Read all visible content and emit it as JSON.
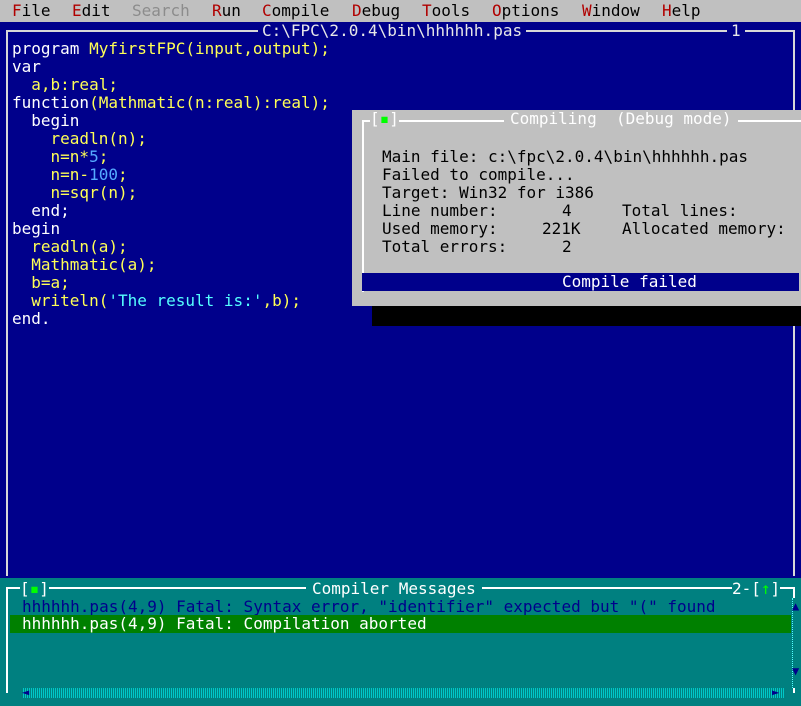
{
  "menu": [
    {
      "hotkey": "F",
      "rest": "ile",
      "enabled": true
    },
    {
      "hotkey": "E",
      "rest": "dit",
      "enabled": true
    },
    {
      "hotkey": "",
      "rest": "Search",
      "enabled": false
    },
    {
      "hotkey": "R",
      "rest": "un",
      "enabled": true
    },
    {
      "hotkey": "C",
      "rest": "ompile",
      "enabled": true
    },
    {
      "hotkey": "D",
      "rest": "ebug",
      "enabled": true
    },
    {
      "hotkey": "T",
      "rest": "ools",
      "enabled": true
    },
    {
      "hotkey": "O",
      "rest": "ptions",
      "enabled": true
    },
    {
      "hotkey": "W",
      "rest": "indow",
      "enabled": true
    },
    {
      "hotkey": "H",
      "rest": "elp",
      "enabled": true
    }
  ],
  "editor": {
    "title": "C:\\FPC\\2.0.4\\bin\\hhhhhh.pas",
    "window_number": "1",
    "lines": [
      "program MyfirstFPC(input,output);",
      "var",
      "  a,b:real;",
      "function(Mathmatic(n:real):real);",
      "  begin",
      "    readln(n);",
      "    n=n*5;",
      "    n=n-100;",
      "    n=sqr(n);",
      "  end;",
      "begin",
      "  readln(a);",
      "  Mathmatic(a);",
      "  b=a;",
      "  writeln('The result is:',b);",
      "end."
    ]
  },
  "dialog": {
    "close_box": "[▪]",
    "title": "Compiling  (Debug mode)",
    "main_file": "Main file: c:\\fpc\\2.0.4\\bin\\hhhhhh.pas",
    "status_line": "Failed to compile...",
    "target": "Target: Win32 for i386",
    "line_number_label": "Line number:",
    "line_number_value": "4",
    "total_lines_label": "Total lines:",
    "used_memory_label": "Used memory:",
    "used_memory_value": "221K",
    "allocated_memory_label": "Allocated memory:",
    "total_errors_label": "Total errors:",
    "total_errors_value": "2",
    "result": "Compile failed"
  },
  "messages": {
    "close_box": "[▪]",
    "title": "Compiler Messages",
    "window_number": "2",
    "zoom_box": "[↑]",
    "lines": [
      "hhhhhh.pas(4,9) Fatal: Syntax error, \"identifier\" expected but \"(\" found",
      "hhhhhh.pas(4,9) Fatal: Compilation aborted"
    ],
    "selected_index": 1
  },
  "colors": {
    "editor_bg": "#00008b",
    "messages_bg": "#008080",
    "dialog_bg": "#c0c0c0",
    "highlight": "#008000"
  }
}
